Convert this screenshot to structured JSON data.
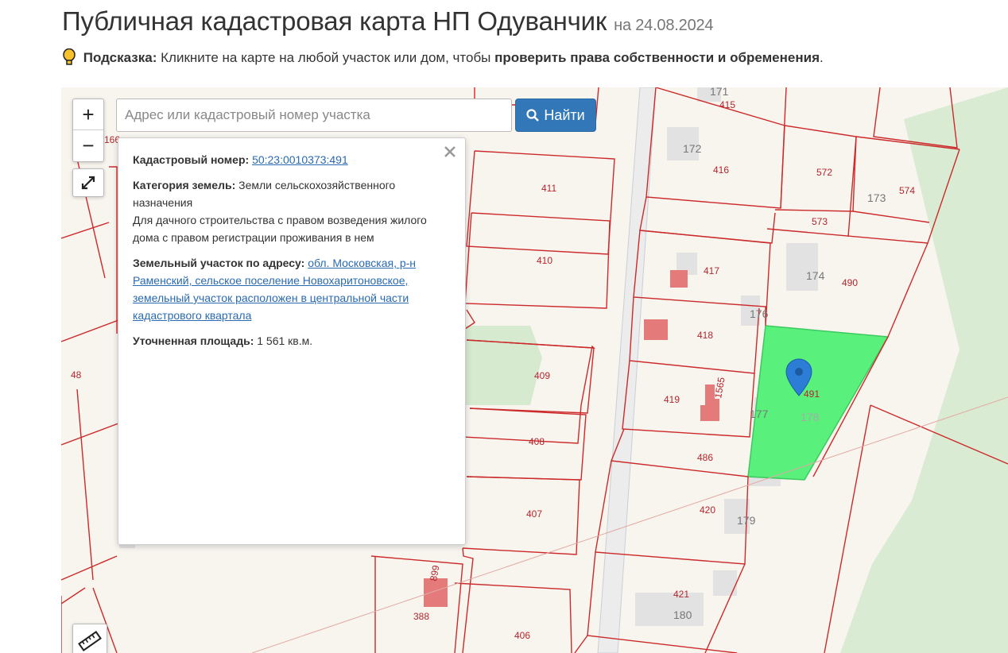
{
  "header": {
    "title": "Публичная кадастровая карта НП Одуванчик",
    "date": "на 24.08.2024",
    "hint_label": "Подсказка:",
    "hint_text": "Кликните на карте на любой участок или дом, чтобы",
    "hint_bold": "проверить права собственности и обременения",
    "hint_end": "."
  },
  "search": {
    "placeholder": "Адрес или кадастровый номер участка",
    "button_label": "Найти"
  },
  "zoom": {
    "in": "+",
    "out": "−"
  },
  "popup": {
    "cadastral_label": "Кадастровый номер:",
    "cadastral_value": "50:23:0010373:491",
    "category_label": "Категория земель:",
    "category_value": "Земли сельскохозяйственного назначения",
    "usage": "Для дачного строительства с правом возведения жилого дома с правом регистрации проживания в нем",
    "address_label": "Земельный участок по адресу:",
    "address_value": "обл. Московская, р-н Раменский, сельское поселение Новохаритоновское, земельный участок расположен в центральной части кадастрового квартала",
    "area_label": "Уточненная площадь:",
    "area_value": "1 561 кв.м."
  },
  "map": {
    "selected_parcel": "491",
    "parcel_labels": [
      "171",
      "415",
      "172",
      "416",
      "572",
      "574",
      "173",
      "573",
      "411",
      "410",
      "417",
      "174",
      "490",
      "176",
      "418",
      "409",
      "419",
      "1565",
      "177",
      "178",
      "408",
      "486",
      "407",
      "420",
      "179",
      "48",
      "421",
      "180",
      "388",
      "406",
      "166",
      "899"
    ],
    "colors": {
      "boundary": "#cc2a2a",
      "label": "#b3262e",
      "selected_fill": "#59f07c",
      "marker": "#2c7dd6",
      "forest": "#d6ead0",
      "road": "#e8e8e8"
    }
  }
}
